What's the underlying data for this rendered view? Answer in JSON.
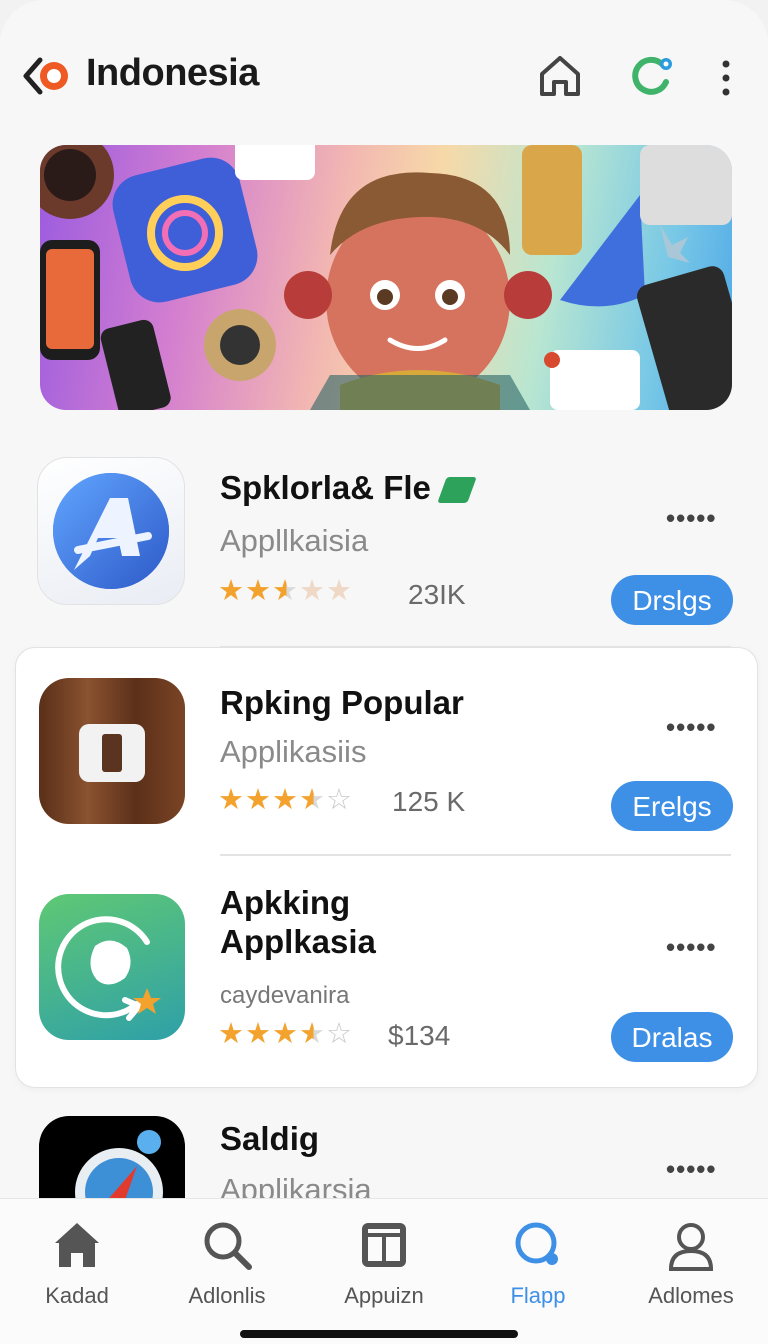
{
  "header": {
    "title": "Indonesia",
    "icons": [
      "back-logo-icon",
      "home-icon",
      "refresh-icon",
      "more-vertical-icon"
    ]
  },
  "banner": {
    "description_icon": "featured-banner"
  },
  "apps": [
    {
      "name": "Spklorla& Fle",
      "category": "Appllkaisia",
      "rating": 2.5,
      "rating_count": "23IK",
      "action": "Drslgs",
      "more": "•••••",
      "icon": "app-store-a-icon",
      "icon_color": "#3a7be0"
    },
    {
      "name": "Rpking Popular",
      "category": "Applikasiis",
      "rating": 3.5,
      "rating_count": "125 K",
      "action": "Erelgs",
      "more": "•••••",
      "icon": "wood-tile-icon",
      "icon_color": "#6b3f22"
    },
    {
      "name_line1": "Apkking",
      "name_line2": "Applkasia",
      "category": "caydevanira",
      "rating": 3.5,
      "rating_count": "$134",
      "action": "Dralas",
      "more": "•••••",
      "icon": "map-rotate-icon",
      "icon_color": "#3fb87a"
    },
    {
      "name": "Saldig",
      "category": "Applikarsia",
      "more": "•••••",
      "icon": "camera-compass-icon",
      "icon_color": "#000000"
    }
  ],
  "bottom_nav": [
    {
      "label": "Kadad",
      "icon": "home-filled-icon"
    },
    {
      "label": "Adlonlis",
      "icon": "search-icon"
    },
    {
      "label": "Appuizn",
      "icon": "grid-box-icon"
    },
    {
      "label": "Flapp",
      "icon": "search-circle-icon",
      "active": true
    },
    {
      "label": "Adlomes",
      "icon": "profile-icon"
    }
  ],
  "colors": {
    "accent": "#3d90e6",
    "star": "#f2a22d",
    "text_primary": "#111111",
    "text_secondary": "#8a8a8a"
  }
}
